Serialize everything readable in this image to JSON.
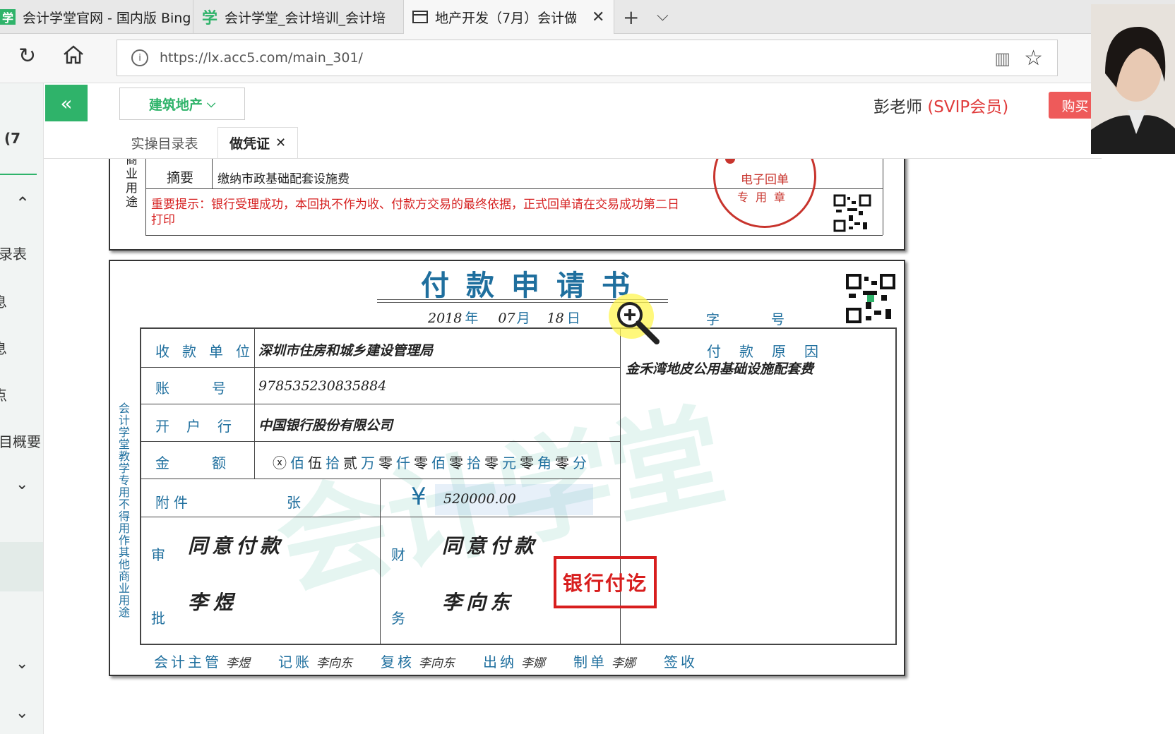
{
  "browser": {
    "tabs": [
      {
        "label": "会计学堂官网 - 国内版 Bing"
      },
      {
        "label": "学",
        "title": "会计学堂_会计培训_会计培"
      },
      {
        "label": "地产开发（7月）会计做"
      }
    ],
    "url": "https://lx.acc5.com/main_301/"
  },
  "left_panel": {
    "items": [
      "(7",
      "录表",
      "息",
      "息",
      "点",
      "目概要"
    ]
  },
  "app": {
    "category": "建筑地产",
    "user_name": "彭老师",
    "user_level": "(SVIP会员)",
    "buy": "购买",
    "tabs": [
      "实操目录表",
      "做凭证"
    ]
  },
  "receipt": {
    "side_text": "商业用途",
    "summary_label": "摘要",
    "summary_value": "缴纳市政基础配套设施费",
    "notice": "重要提示：银行受理成功，本回执不作为收、付款方交易的最终依据，正式回单请在交易成功第二日打印",
    "stamp_line1": "电子回单",
    "stamp_line2": "专用章",
    "stamp_top": "行"
  },
  "payment_form": {
    "title": "付款申请书",
    "date": {
      "year": "2018",
      "year_unit": "年",
      "month": "07",
      "month_unit": "月",
      "day": "18",
      "day_unit": "日"
    },
    "zi": "字",
    "hao": "号",
    "payee_label": "收款单位",
    "payee": "深圳市住房和城乡建设管理局",
    "account_label": "账号",
    "account": "978535230835884",
    "bank_label": "开户行",
    "bank": "中国银行股份有限公司",
    "amount_label": "金额",
    "amount_words": [
      "ⓧ",
      "佰",
      "伍",
      "拾",
      "贰",
      "万",
      "零",
      "仟",
      "零",
      "佰",
      "零",
      "拾",
      "零",
      "元",
      "零",
      "角",
      "零",
      "分"
    ],
    "reason_label": "付款原因",
    "reason": "金禾湾地皮公用基础设施配套费",
    "attach_label": "附件",
    "attach_unit": "张",
    "yen": "¥",
    "amount_number": "520000.00",
    "approve_label_top": "审",
    "approve_label_bottom": "批",
    "approve_text": "同意付款",
    "approver": "李煜",
    "finance_label_top": "财",
    "finance_label_bottom": "务",
    "finance_text": "同意付款",
    "finance_person": "李向东",
    "bank_stamp": "银行付讫",
    "side_note": "会计学堂教学专用 不得用作其他商业用途",
    "footer": [
      {
        "label": "会计主管",
        "name": "李煜"
      },
      {
        "label": "记账",
        "name": "李向东"
      },
      {
        "label": "复核",
        "name": "李向东"
      },
      {
        "label": "出纳",
        "name": "李娜"
      },
      {
        "label": "制单",
        "name": "李娜"
      },
      {
        "label": "签收",
        "name": ""
      }
    ]
  },
  "watermark": "会计学堂"
}
